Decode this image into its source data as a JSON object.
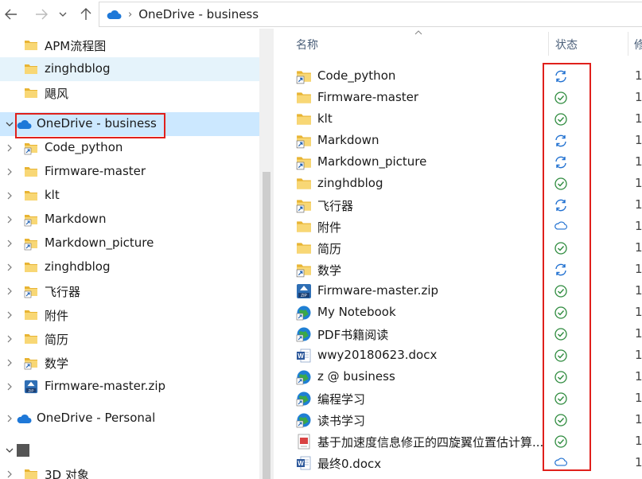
{
  "toolbar": {
    "back_icon": "back-arrow-icon",
    "forward_icon": "forward-arrow-icon",
    "recent_icon": "chevron-down-icon",
    "up_icon": "up-arrow-icon",
    "address_path": "OneDrive - business"
  },
  "nav": {
    "items": [
      {
        "label": "APM流程图",
        "icon": "folder-icon",
        "level": 1,
        "chev": ""
      },
      {
        "label": "zinghdblog",
        "icon": "folder-icon",
        "level": 1,
        "chev": "",
        "state": "hover"
      },
      {
        "label": "飓风",
        "icon": "folder-icon",
        "level": 1,
        "chev": ""
      },
      {
        "label": "OneDrive - business",
        "icon": "cloud-icon",
        "level": 0,
        "chev": "down",
        "state": "selected"
      },
      {
        "label": "Code_python",
        "icon": "folder-shortcut-icon",
        "level": 1,
        "chev": "right"
      },
      {
        "label": "Firmware-master",
        "icon": "folder-icon",
        "level": 1,
        "chev": "right"
      },
      {
        "label": "klt",
        "icon": "folder-icon",
        "level": 1,
        "chev": "right"
      },
      {
        "label": "Markdown",
        "icon": "folder-shortcut-icon",
        "level": 1,
        "chev": "right"
      },
      {
        "label": "Markdown_picture",
        "icon": "folder-shortcut-icon",
        "level": 1,
        "chev": "right"
      },
      {
        "label": "zinghdblog",
        "icon": "folder-icon",
        "level": 1,
        "chev": "right"
      },
      {
        "label": "飞行器",
        "icon": "folder-shortcut-icon",
        "level": 1,
        "chev": "right"
      },
      {
        "label": "附件",
        "icon": "folder-icon",
        "level": 1,
        "chev": "right"
      },
      {
        "label": "简历",
        "icon": "folder-icon",
        "level": 1,
        "chev": "right"
      },
      {
        "label": "数学",
        "icon": "folder-shortcut-icon",
        "level": 1,
        "chev": "right"
      },
      {
        "label": "Firmware-master.zip",
        "icon": "zip-icon",
        "level": 1,
        "chev": "right"
      },
      {
        "label": "OneDrive - Personal",
        "icon": "cloud-icon",
        "level": 0,
        "chev": "right"
      },
      {
        "label": "",
        "icon": "pc-icon",
        "level": 0,
        "chev": "down"
      },
      {
        "label": "3D 对象",
        "icon": "folder-icon",
        "level": 1,
        "chev": "right"
      }
    ]
  },
  "columns": {
    "name": "名称",
    "status": "状态",
    "modified": "修"
  },
  "files": [
    {
      "name": "Code_python",
      "icon": "folder-shortcut-icon",
      "status": "sync",
      "extra": "1"
    },
    {
      "name": "Firmware-master",
      "icon": "folder-icon",
      "status": "ok",
      "extra": "1"
    },
    {
      "name": "klt",
      "icon": "folder-icon",
      "status": "ok",
      "extra": "1"
    },
    {
      "name": "Markdown",
      "icon": "folder-shortcut-icon",
      "status": "sync",
      "extra": "1"
    },
    {
      "name": "Markdown_picture",
      "icon": "folder-shortcut-icon",
      "status": "sync",
      "extra": "1"
    },
    {
      "name": "zinghdblog",
      "icon": "folder-icon",
      "status": "ok",
      "extra": "1"
    },
    {
      "name": "飞行器",
      "icon": "folder-shortcut-icon",
      "status": "sync",
      "extra": "1"
    },
    {
      "name": "附件",
      "icon": "folder-icon",
      "status": "cloud",
      "extra": "1"
    },
    {
      "name": "简历",
      "icon": "folder-icon",
      "status": "ok",
      "extra": "1"
    },
    {
      "name": "数学",
      "icon": "folder-shortcut-icon",
      "status": "sync",
      "extra": "1"
    },
    {
      "name": "Firmware-master.zip",
      "icon": "zip-icon",
      "status": "ok",
      "extra": "1"
    },
    {
      "name": "My Notebook",
      "icon": "globe-link-icon",
      "status": "ok",
      "extra": "1"
    },
    {
      "name": "PDF书籍阅读",
      "icon": "globe-link-icon",
      "status": "ok",
      "extra": "1"
    },
    {
      "name": "wwy20180623.docx",
      "icon": "word-doc-icon",
      "status": "ok",
      "extra": "1"
    },
    {
      "name": "z @ business",
      "icon": "globe-link-icon",
      "status": "ok",
      "extra": "1"
    },
    {
      "name": "编程学习",
      "icon": "globe-link-icon",
      "status": "ok",
      "extra": "1"
    },
    {
      "name": "读书学习",
      "icon": "globe-link-icon",
      "status": "ok",
      "extra": "1"
    },
    {
      "name": "基于加速度信息修正的四旋翼位置估计算...",
      "icon": "pdf-doc-icon",
      "status": "ok",
      "extra": "1"
    },
    {
      "name": "最终0.docx",
      "icon": "word-doc-icon",
      "status": "cloud",
      "extra": "1"
    }
  ],
  "colors": {
    "selected_bg": "#cce8ff",
    "hover_bg": "#e5f3fb",
    "highlight_border": "#e0201c",
    "status_ok": "#2e8b3e",
    "status_sync": "#1e6fd0",
    "status_cloud": "#1e6fd0",
    "folder": "#f2c94c"
  }
}
